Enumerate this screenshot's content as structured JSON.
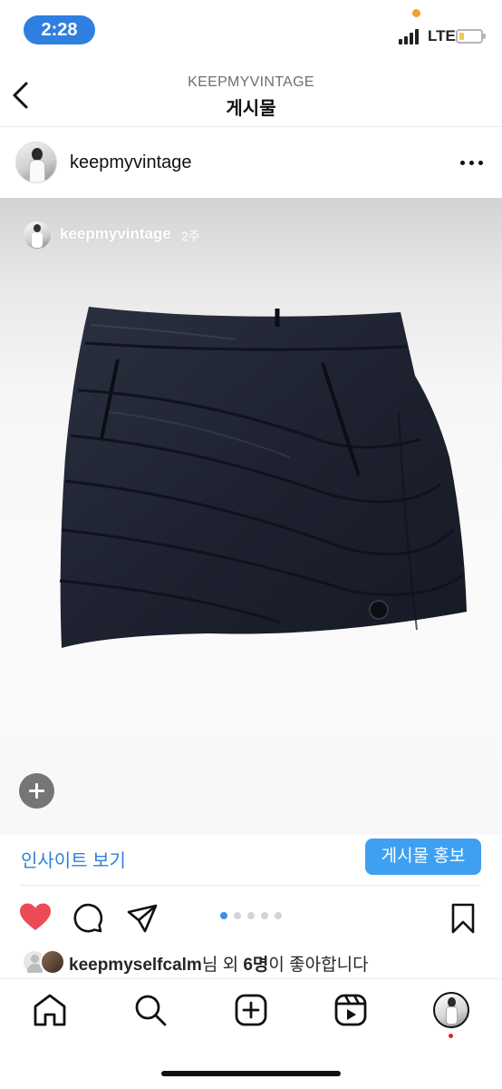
{
  "status_bar": {
    "time": "2:28",
    "network": "LTE",
    "colors": {
      "time_pill": "#2f7fe0",
      "battery": "#f2c94c"
    }
  },
  "header": {
    "subtitle": "KEEPMYVINTAGE",
    "title": "게시물",
    "back_icon": "chevron-left-icon"
  },
  "post": {
    "username": "keepmyvintage",
    "more_icon": "more-horizontal-icon",
    "image": {
      "tag_username": "keepmyvintage",
      "tag_time": "2주",
      "description": "navy quilted puffer mini skirt",
      "plus_icon": "plus-icon"
    }
  },
  "insights": {
    "link_label": "인사이트 보기",
    "promote_label": "게시물 홍보",
    "colors": {
      "link": "#2f80d6",
      "button": "#3fa0f2"
    }
  },
  "actions": {
    "like_icon": "heart-icon",
    "liked": true,
    "comment_icon": "comment-icon",
    "share_icon": "share-icon",
    "save_icon": "bookmark-icon",
    "carousel": {
      "total": 5,
      "active_index": 1
    },
    "colors": {
      "heart": "#ed4956",
      "active_dot": "#3b8fe4"
    }
  },
  "likes": {
    "liker": "keepmyselfcalm",
    "suffix_1": "님 외 ",
    "count": "6명",
    "suffix_2": "이 좋아합니다"
  },
  "tab_bar": {
    "items": [
      {
        "name": "home",
        "icon": "home-icon"
      },
      {
        "name": "search",
        "icon": "search-icon"
      },
      {
        "name": "create",
        "icon": "add-post-icon"
      },
      {
        "name": "reels",
        "icon": "reels-icon"
      },
      {
        "name": "profile",
        "icon": "profile-avatar"
      }
    ]
  }
}
